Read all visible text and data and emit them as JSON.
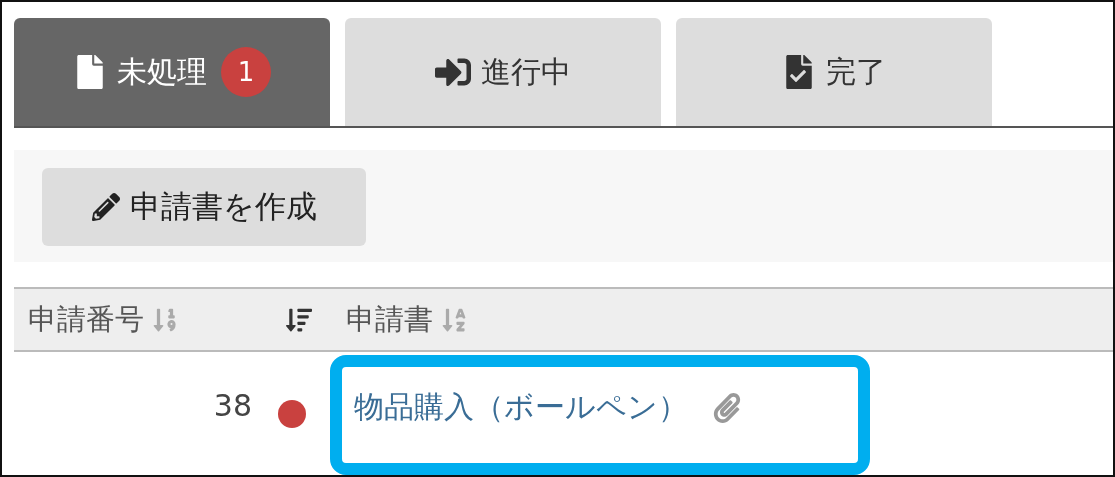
{
  "tabs": [
    {
      "label": "未処理",
      "kind": "inbox",
      "selected": true,
      "badge": "1"
    },
    {
      "label": "進行中",
      "kind": "progress",
      "selected": false
    },
    {
      "label": "完了",
      "kind": "done",
      "selected": false
    }
  ],
  "toolbar": {
    "create_button": "申請書を作成"
  },
  "table": {
    "columns": [
      {
        "label": "申請番号",
        "kind": "numeric-sort"
      },
      {
        "kind": "priority-sort"
      },
      {
        "label": "申請書",
        "kind": "alpha-sort"
      }
    ],
    "rows": [
      {
        "number": "38",
        "color": "#c9413f",
        "title": "物品購入（ボールペン）",
        "attachment": true,
        "highlighted": true
      }
    ]
  }
}
